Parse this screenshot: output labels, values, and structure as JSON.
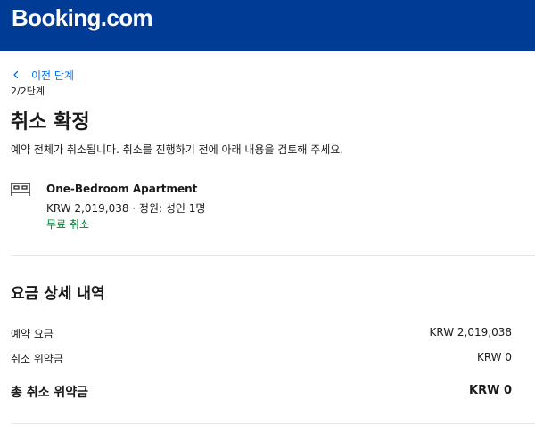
{
  "header": {
    "logo_text": "Booking.com",
    "background": "#003b95"
  },
  "nav": {
    "back_label": "이전 단계",
    "step_label": "2/2단계"
  },
  "main": {
    "title": "취소 확정",
    "description": "예약 전체가 취소됩니다. 취소를 진행하기 전에 아래 내용을 검토해 주세요."
  },
  "property": {
    "icon": "bed-icon",
    "name": "One-Bedroom Apartment",
    "detail": "KRW 2,019,038 · 정원: 성인 1명",
    "free_cancel": "무료 취소",
    "free_cancel_color": "#008234"
  },
  "pricing": {
    "title": "요금 상세 내역",
    "rows": [
      {
        "label": "예약 요금",
        "value": "KRW 2,019,038"
      },
      {
        "label": "취소 위약금",
        "value": "KRW 0"
      }
    ],
    "total": {
      "label": "총 취소 위약금",
      "value": "KRW 0"
    }
  },
  "colors": {
    "link": "#006ce4",
    "divider": "#e7e7e7"
  }
}
